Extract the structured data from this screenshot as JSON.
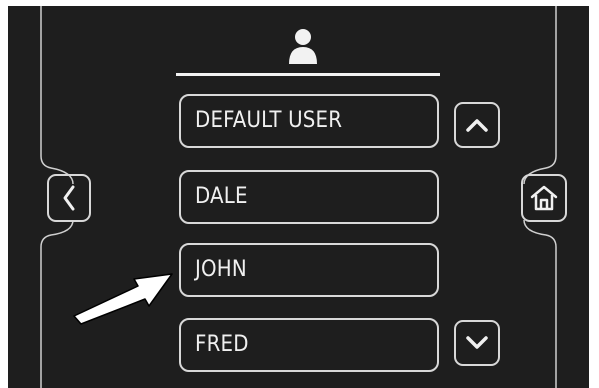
{
  "colors": {
    "screen_background": "#1e1e1e",
    "foreground": "#f0f0f0",
    "outline": "#d8d8d8",
    "page_background": "#ffffff"
  },
  "header": {
    "icon": "user-icon"
  },
  "user_list": {
    "items": [
      {
        "label": "DEFAULT USER"
      },
      {
        "label": "DALE"
      },
      {
        "label": "JOHN"
      },
      {
        "label": "FRED"
      }
    ],
    "highlighted_index": 2
  },
  "controls": {
    "back_icon": "chevron-left-icon",
    "home_icon": "home-icon",
    "scroll_up_icon": "chevron-up-icon",
    "scroll_down_icon": "chevron-down-icon"
  },
  "callout": {
    "icon": "pointer-arrow-icon",
    "target_item_index": 2
  }
}
